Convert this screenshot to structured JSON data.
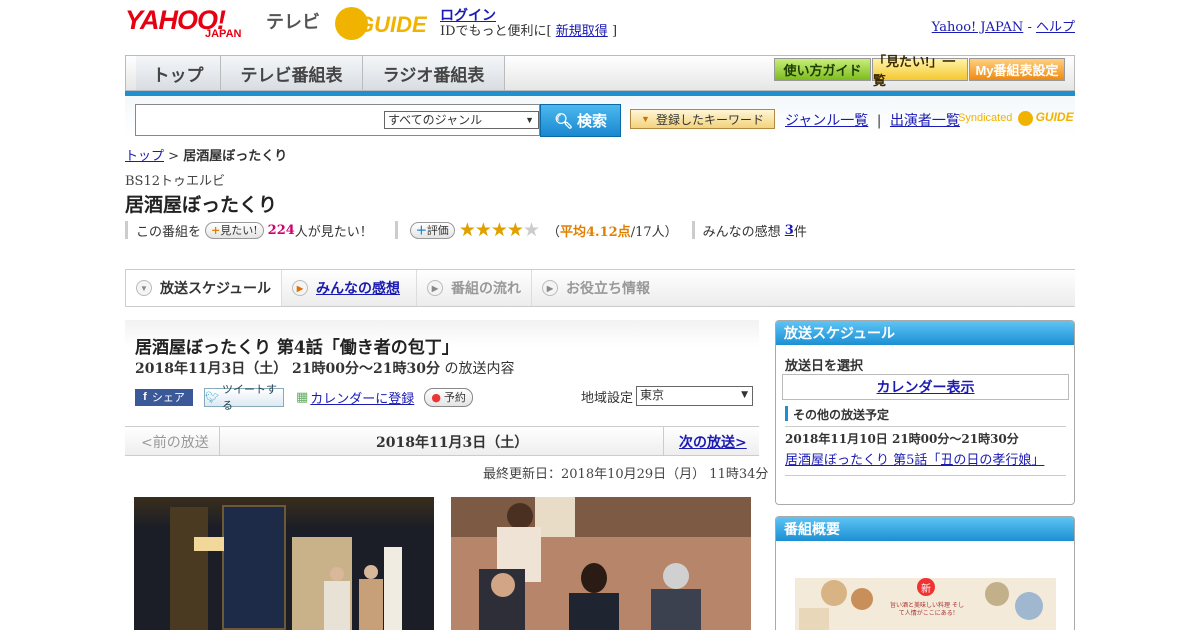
{
  "header": {
    "logo_brand": "YAHOO!",
    "logo_japan": "JAPAN",
    "logo_tv": "テレビ",
    "gguide_logo": "GUIDE",
    "login_link": "ログイン",
    "login_prompt": "IDでもっと便利に[",
    "signup_link": "新規取得",
    "login_suffix": "]",
    "yahoo_japan_link": "Yahoo! JAPAN",
    "separator": "-",
    "help_link": "ヘルプ"
  },
  "nav": {
    "tabs": [
      {
        "label": "トップ"
      },
      {
        "label": "テレビ番組表"
      },
      {
        "label": "ラジオ番組表"
      }
    ],
    "buttons": [
      {
        "label": "使い方ガイド"
      },
      {
        "label": "「見たい!」一覧"
      },
      {
        "label": "My番組表設定"
      }
    ]
  },
  "search": {
    "query": "",
    "genre_selected": "すべてのジャンル",
    "search_button": "検索",
    "keyword_button": "登録したキーワード",
    "genre_list_link": "ジャンル一覧",
    "pipe": "|",
    "performer_link": "出演者一覧",
    "syndicated": "Syndicated"
  },
  "breadcrumb": {
    "home": "トップ",
    "sep": ">",
    "current": "居酒屋ぼったくり"
  },
  "program": {
    "station": "BS12トゥエルビ",
    "title": "居酒屋ぼったくり",
    "want_prefix": "この番組を",
    "want_button": "見たい!",
    "want_count": "224",
    "want_suffix": "人が見たい！",
    "rating_button": "評価",
    "rating_stars_value": 4.12,
    "rating_avg_open": "（",
    "rating_avg": "平均4.12点",
    "rating_people": "/17人）",
    "reviews_prefix": "みんなの感想",
    "reviews_count": "3",
    "reviews_suffix": "件"
  },
  "tabs": [
    {
      "label": "放送スケジュール"
    },
    {
      "label": "みんなの感想"
    },
    {
      "label": "番組の流れ"
    },
    {
      "label": "お役立ち情報"
    }
  ],
  "episode": {
    "title": "居酒屋ぼったくり 第4話「働き者の包丁」",
    "datetime": "2018年11月3日（土） 21時00分～21時30分",
    "datetime_suffix": "の放送内容",
    "share_fb": "シェア",
    "tweet": "ツイートする",
    "calendar_link": "カレンダーに登録",
    "reserve": "予約",
    "region_label": "地域設定",
    "region_value": "東京",
    "prev": "<前の放送",
    "current_date": "2018年11月3日（土）",
    "next": "次の放送>",
    "updated": "最終更新日：2018年10月29日（月） 11時34分"
  },
  "sidebar": {
    "schedule_title": "放送スケジュール",
    "select_date": "放送日を選択",
    "calendar_link": "カレンダー表示",
    "other_title": "その他の放送予定",
    "other_date": "2018年11月10日 21時00分～21時30分",
    "other_link": "居酒屋ぼったくり 第5話「丑の日の孝行娘」",
    "summary_title": "番組概要",
    "summary_banner_top": "新",
    "summary_banner_text": "旨い酒と美味しい料理 そして人情がここにある!"
  },
  "colors": {
    "accent_blue": "#1e90d0",
    "yahoo_red": "#e60012",
    "gguide_yellow": "#f0b400",
    "star_gold": "#e0a000",
    "want_count_red": "#d0006f"
  }
}
